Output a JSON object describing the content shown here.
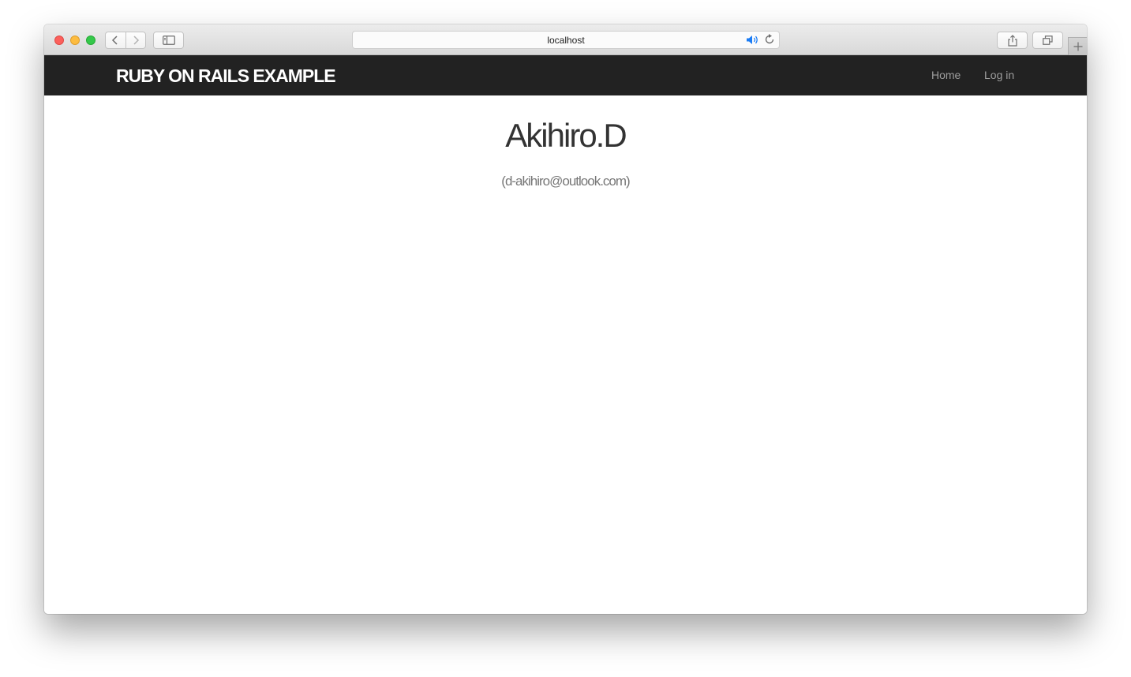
{
  "browser": {
    "url": "localhost",
    "icons": {
      "back": "chevron-left-icon",
      "forward": "chevron-right-icon",
      "sidebar": "sidebar-icon",
      "audio": "speaker-icon",
      "reload": "reload-icon",
      "share": "share-icon",
      "tabs": "tabs-overview-icon",
      "new_tab": "plus-icon"
    },
    "colors": {
      "close": "#fc605c",
      "minimize": "#fdbc40",
      "maximize": "#34c84a",
      "audio_accent": "#1a7cf5"
    }
  },
  "navbar": {
    "brand": "RUBY ON RAILS EXAMPLE",
    "links": [
      {
        "label": "Home"
      },
      {
        "label": "Log in"
      }
    ],
    "background": "#222222"
  },
  "profile": {
    "name": "Akihiro.D",
    "email": "(d-akihiro@outlook.com)"
  }
}
